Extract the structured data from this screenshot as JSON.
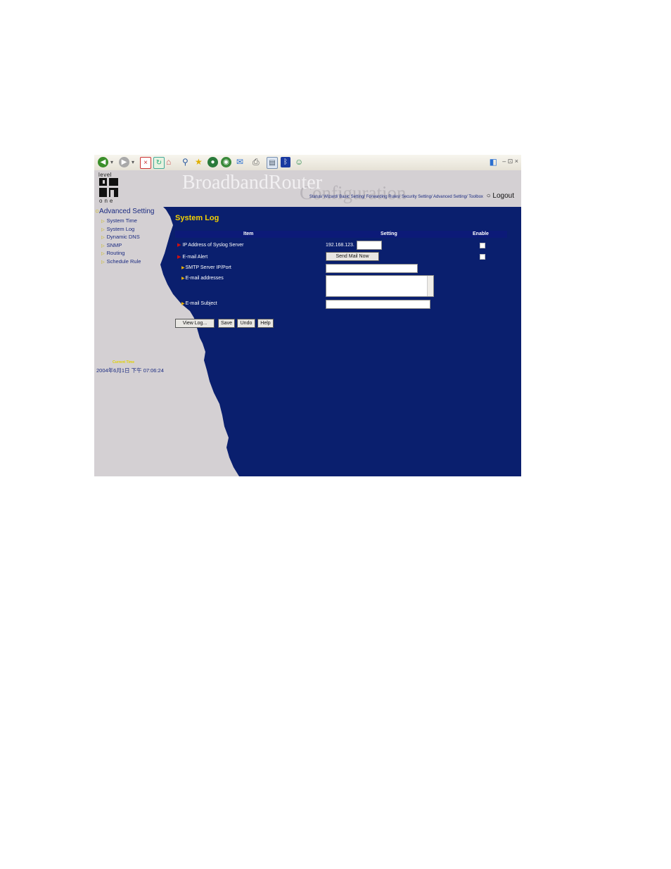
{
  "browser": {
    "toolbar_icons": [
      "back-icon",
      "forward-icon",
      "stop-icon",
      "refresh-icon",
      "home-icon",
      "search-icon",
      "favorites-icon",
      "media-icon",
      "history-icon",
      "mail-icon",
      "print-icon",
      "edit-icon",
      "bluetooth-icon",
      "messenger-icon"
    ],
    "window_controls": "– ⊡ ×"
  },
  "header": {
    "logo_top": "level",
    "logo_bottom": "one",
    "brand_title": "BroadbandRouter",
    "brand_subtitle": "Configuration",
    "nav": "Status/ Wizard/ Basic Setting/ Forwarding Rules/ Security Setting/ Advanced Setting/ Toolbox",
    "logout": "Logout"
  },
  "sidebar": {
    "heading": "Advanced Setting",
    "items": [
      {
        "label": "System Time"
      },
      {
        "label": "System Log"
      },
      {
        "label": "Dynamic DNS"
      },
      {
        "label": "SNMP"
      },
      {
        "label": "Routing"
      },
      {
        "label": "Schedule Rule"
      }
    ],
    "current_time_label": "Current Time",
    "current_time_value": "2004年6月1日 下午 07:06:24"
  },
  "main": {
    "title": "System Log",
    "columns": {
      "item": "Item",
      "setting": "Setting",
      "enable": "Enable"
    },
    "rows": {
      "syslog_label": "IP Address of Syslog Server",
      "syslog_prefix": "192.168.123.",
      "syslog_value": "",
      "email_alert_label": "E-mail Alert",
      "send_mail_button": "Send Mail Now",
      "smtp_label": "SMTP Server IP/Port",
      "smtp_value": "",
      "email_addresses_label": "E-mail addresses",
      "email_addresses_value": "",
      "email_subject_label": "E-mail Subject",
      "email_subject_value": ""
    },
    "buttons": {
      "view_log": "View Log...",
      "save": "Save",
      "undo": "Undo",
      "help": "Help"
    },
    "syslog_enabled": false,
    "email_alert_enabled": false
  },
  "colors": {
    "panel_blue": "#0a1f6e",
    "header_blue": "#0c1a78",
    "title_yellow": "#f5d200",
    "sidebar_gray": "#d4d0d3"
  }
}
